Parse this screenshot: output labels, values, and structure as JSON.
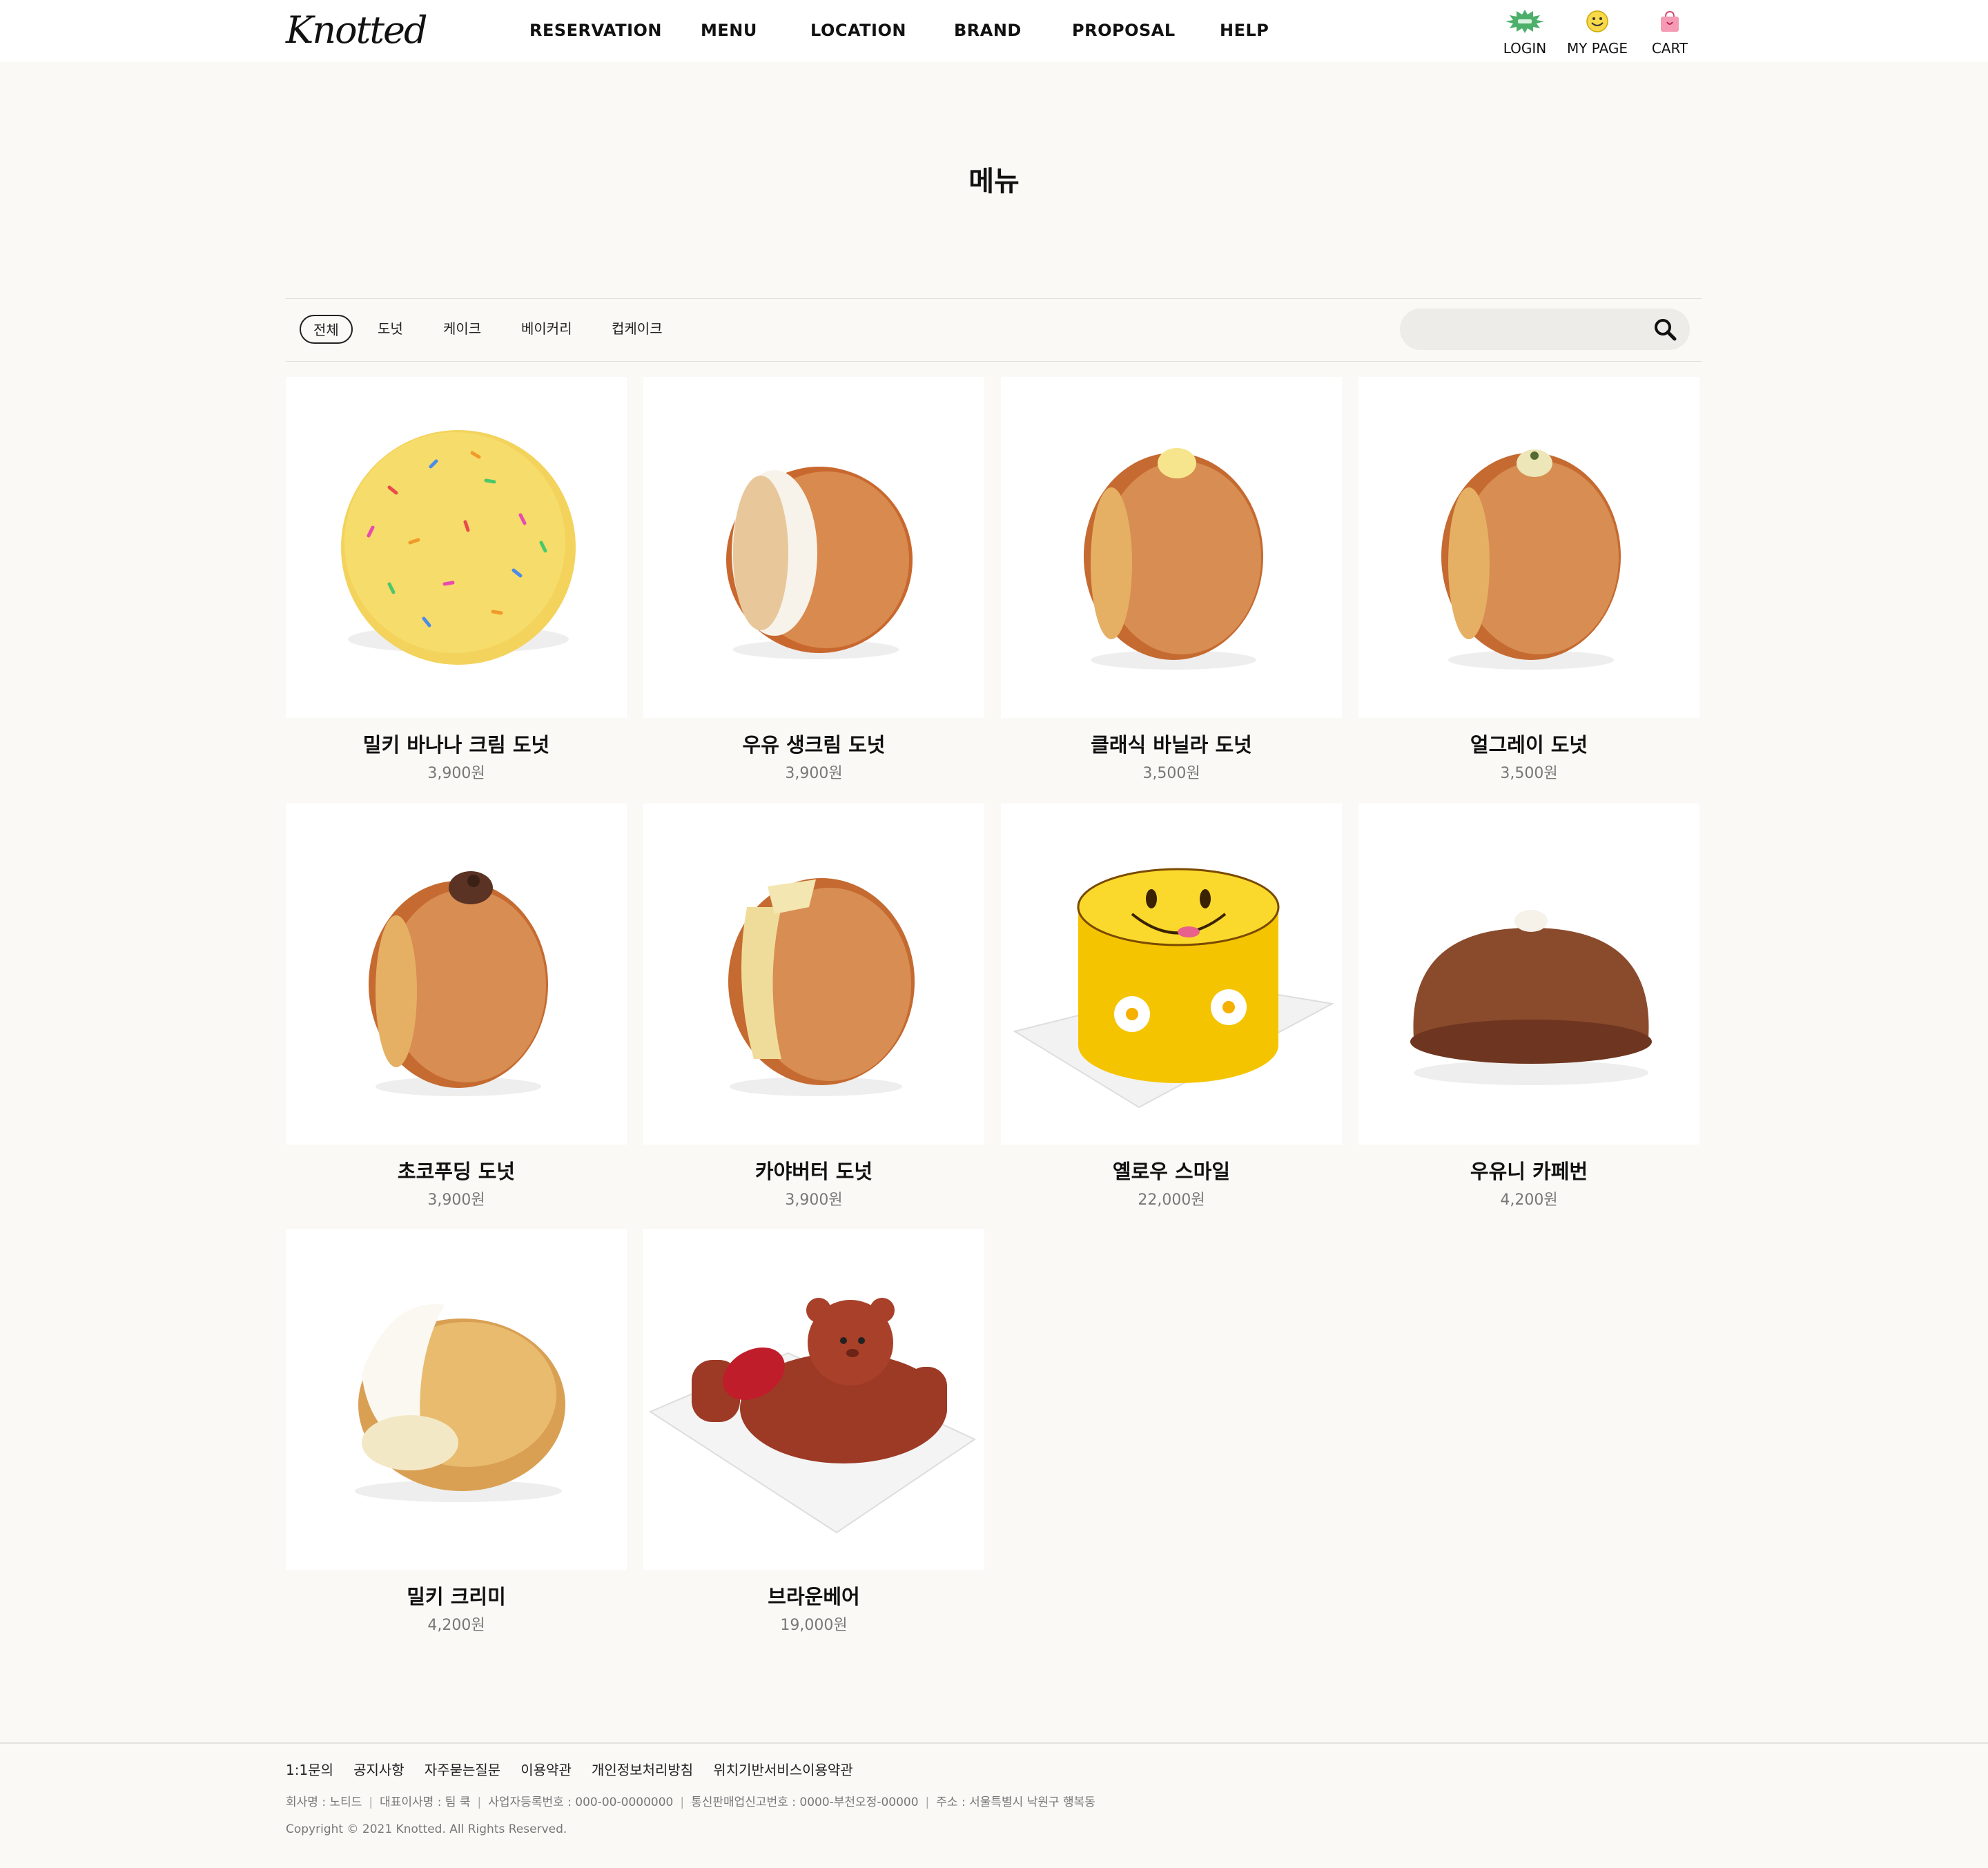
{
  "brand": {
    "logo_text": "Knotted"
  },
  "nav": {
    "items": [
      {
        "label": "RESERVATION"
      },
      {
        "label": "MENU"
      },
      {
        "label": "LOCATION"
      },
      {
        "label": "BRAND"
      },
      {
        "label": "PROPOSAL"
      },
      {
        "label": "HELP"
      }
    ]
  },
  "util": {
    "login": {
      "label": "LOGIN",
      "icon": "green-burst-icon"
    },
    "mypage": {
      "label": "MY PAGE",
      "icon": "smiley-icon"
    },
    "cart": {
      "label": "CART",
      "icon": "shopping-bag-icon"
    }
  },
  "page": {
    "title": "메뉴"
  },
  "filters": {
    "categories": [
      "전체",
      "도넛",
      "케이크",
      "베이커리",
      "컵케이크"
    ],
    "active": "전체",
    "search": {
      "placeholder": "",
      "value": "",
      "icon": "search-icon"
    }
  },
  "products": [
    {
      "name": "밀키 바나나 크림 도넛",
      "price": "3,900원"
    },
    {
      "name": "우유 생크림 도넛",
      "price": "3,900원"
    },
    {
      "name": "클래식 바닐라 도넛",
      "price": "3,500원"
    },
    {
      "name": "얼그레이 도넛",
      "price": "3,500원"
    },
    {
      "name": "초코푸딩 도넛",
      "price": "3,900원"
    },
    {
      "name": "카야버터 도넛",
      "price": "3,900원"
    },
    {
      "name": "옐로우 스마일",
      "price": "22,000원"
    },
    {
      "name": "우유니 카페번",
      "price": "4,200원"
    },
    {
      "name": "밀키 크리미",
      "price": "4,200원"
    },
    {
      "name": "브라운베어",
      "price": "19,000원"
    }
  ],
  "footer": {
    "links": [
      "1:1문의",
      "공지사항",
      "자주묻는질문",
      "이용약관",
      "개인정보처리방침",
      "위치기반서비스이용약관"
    ],
    "info": [
      "회사명 : 노티드",
      "대표이사명 : 팀 쿡",
      "사업자등록번호 : 000-00-0000000",
      "통신판매업신고번호 : 0000-부천오정-00000",
      "주소 : 서울특별시 낙원구 행복동"
    ],
    "copyright": "Copyright © 2021 Knotted. All Rights Reserved."
  },
  "colors": {
    "background": "#faf9f6",
    "header": "#ffffff",
    "text": "#111111",
    "price": "#777777",
    "search_bg": "#edece9"
  }
}
